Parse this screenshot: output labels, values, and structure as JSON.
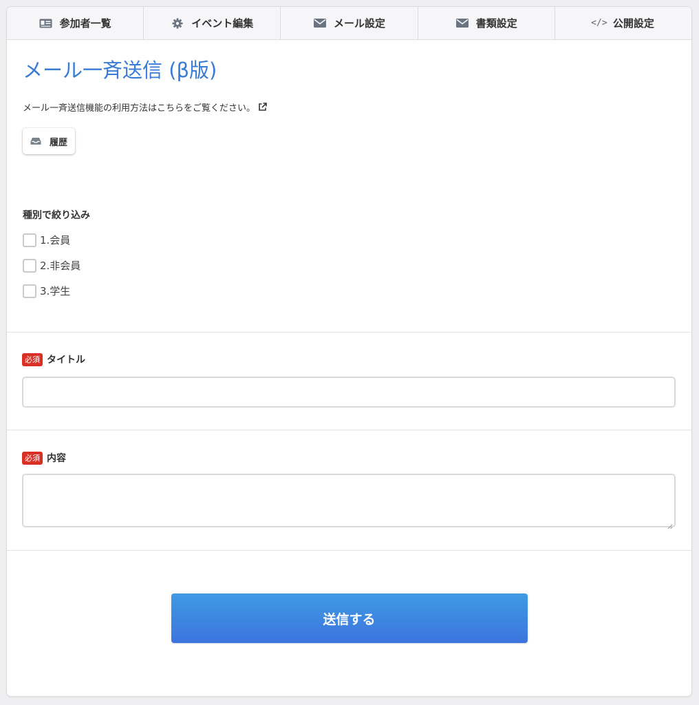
{
  "tabs": [
    {
      "label": "参加者一覧",
      "icon": "id-card-icon"
    },
    {
      "label": "イベント編集",
      "icon": "gear-icon"
    },
    {
      "label": "メール設定",
      "icon": "envelope-icon"
    },
    {
      "label": "書類設定",
      "icon": "envelope-icon"
    },
    {
      "label": "公開設定",
      "icon": "code-icon",
      "icon_text": "</>"
    }
  ],
  "page": {
    "title": "メール一斉送信 (β版)",
    "help_text": "メール一斉送信機能の利用方法はこちらをご覧ください。"
  },
  "history_button": {
    "label": "履歴",
    "icon": "inbox-icon"
  },
  "filter": {
    "label": "種別で絞り込み",
    "options": [
      {
        "label": "1.会員",
        "checked": false
      },
      {
        "label": "2.非会員",
        "checked": false
      },
      {
        "label": "3.学生",
        "checked": false
      }
    ]
  },
  "title_field": {
    "required_badge": "必須",
    "label": "タイトル",
    "value": ""
  },
  "body_field": {
    "required_badge": "必須",
    "label": "内容",
    "value": ""
  },
  "submit_button": {
    "label": "送信する"
  },
  "colors": {
    "title_blue": "#3a7bd5",
    "required_red": "#d93025",
    "button_top": "#3f9ae3",
    "button_bottom": "#3d74de"
  }
}
